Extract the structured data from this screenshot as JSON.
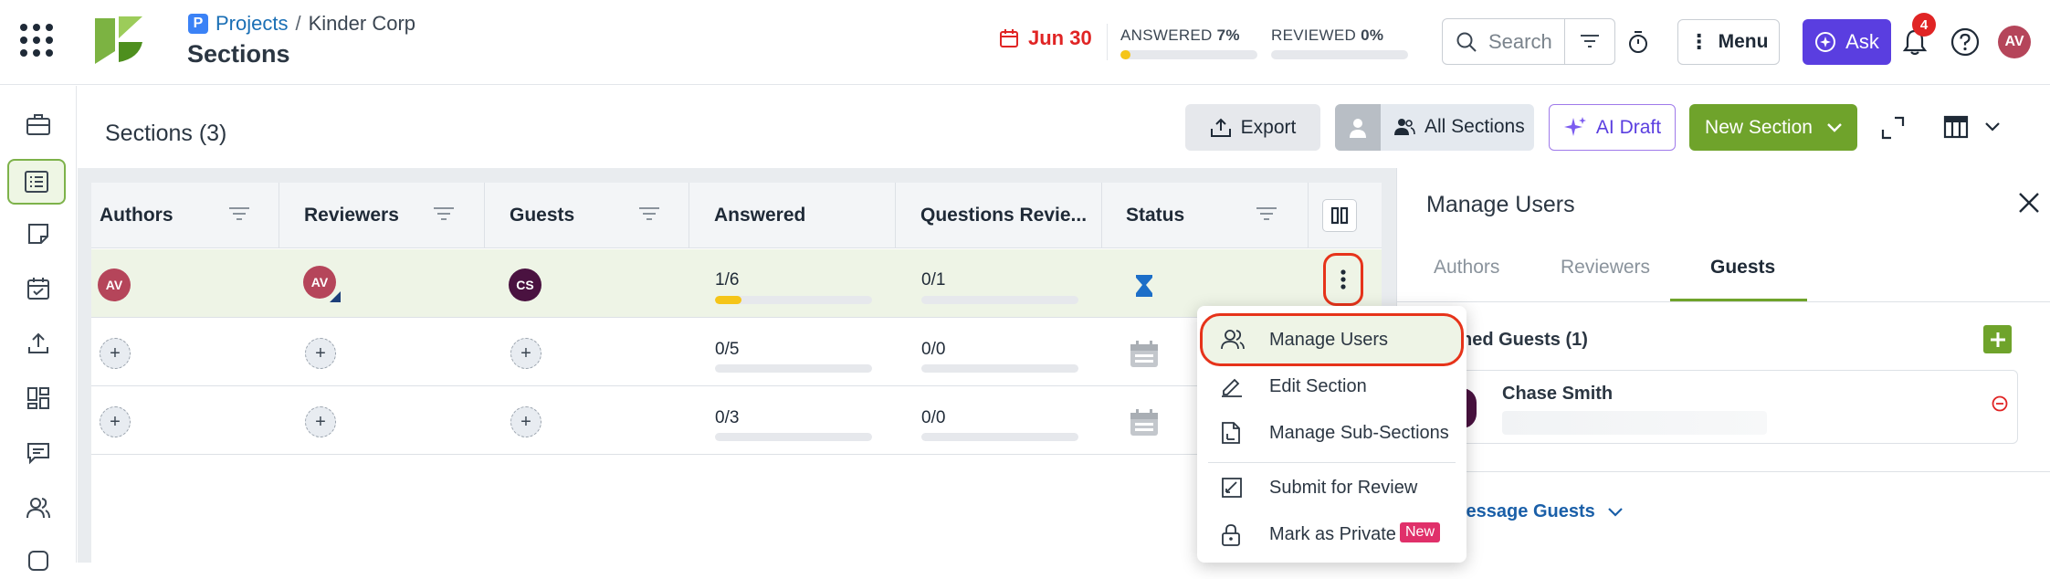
{
  "header": {
    "breadcrumb_link": "Projects",
    "breadcrumb_sep": "/",
    "breadcrumb_current": "Kinder Corp",
    "page_title": "Sections",
    "due_date": "Jun 30",
    "answered_label": "ANSWERED",
    "answered_pct": "7%",
    "answered_fraction": 0.07,
    "reviewed_label": "REVIEWED",
    "reviewed_pct": "0%",
    "reviewed_fraction": 0.0,
    "search_placeholder": "Search",
    "menu_label": "Menu",
    "ask_label": "Ask",
    "notification_count": "4",
    "user_initials": "AV"
  },
  "toolbar": {
    "title": "Sections (3)",
    "export": "Export",
    "all_sections": "All Sections",
    "ai_draft": "AI Draft",
    "new_section": "New Section"
  },
  "table": {
    "columns": [
      "Authors",
      "Reviewers",
      "Guests",
      "Answered",
      "Questions Revie...",
      "Status"
    ],
    "rows": [
      {
        "author": "AV",
        "reviewer": "AV",
        "guest": "CS",
        "answered": "1/6",
        "answered_fraction": 0.167,
        "reviewed": "0/1",
        "reviewed_fraction": 0.0,
        "status": "in-progress-hourglass-icon"
      },
      {
        "author": "+",
        "reviewer": "+",
        "guest": "+",
        "answered": "0/5",
        "answered_fraction": 0.0,
        "reviewed": "0/0",
        "reviewed_fraction": 0.0,
        "status": "calendar-icon"
      },
      {
        "author": "+",
        "reviewer": "+",
        "guest": "+",
        "answered": "0/3",
        "answered_fraction": 0.0,
        "reviewed": "0/0",
        "reviewed_fraction": 0.0,
        "status": "calendar-icon"
      }
    ]
  },
  "context_menu": {
    "items": [
      {
        "label": "Manage Users",
        "icon": "users-icon"
      },
      {
        "label": "Edit Section",
        "icon": "pencil-icon"
      },
      {
        "label": "Manage Sub-Sections",
        "icon": "document-icon"
      },
      {
        "label": "Submit for Review",
        "icon": "submit-icon"
      },
      {
        "label": "Mark as Private",
        "icon": "lock-icon",
        "badge": "New"
      }
    ]
  },
  "panel": {
    "title": "Manage Users",
    "tabs": [
      "Authors",
      "Reviewers",
      "Guests"
    ],
    "active_tab": "Guests",
    "assigned_label": "ned Guests (1)",
    "guest_name": "Chase Smith",
    "message_label": "lessage Guests"
  },
  "colors": {
    "brand_green": "#7cb342",
    "new_section_bg": "#6fa32b",
    "ask_purple": "#5a3ee0",
    "due_red": "#e02424",
    "highlight_red": "#e6331a",
    "row_highlight": "#eef4e6",
    "badge_pink": "#e0306a"
  }
}
